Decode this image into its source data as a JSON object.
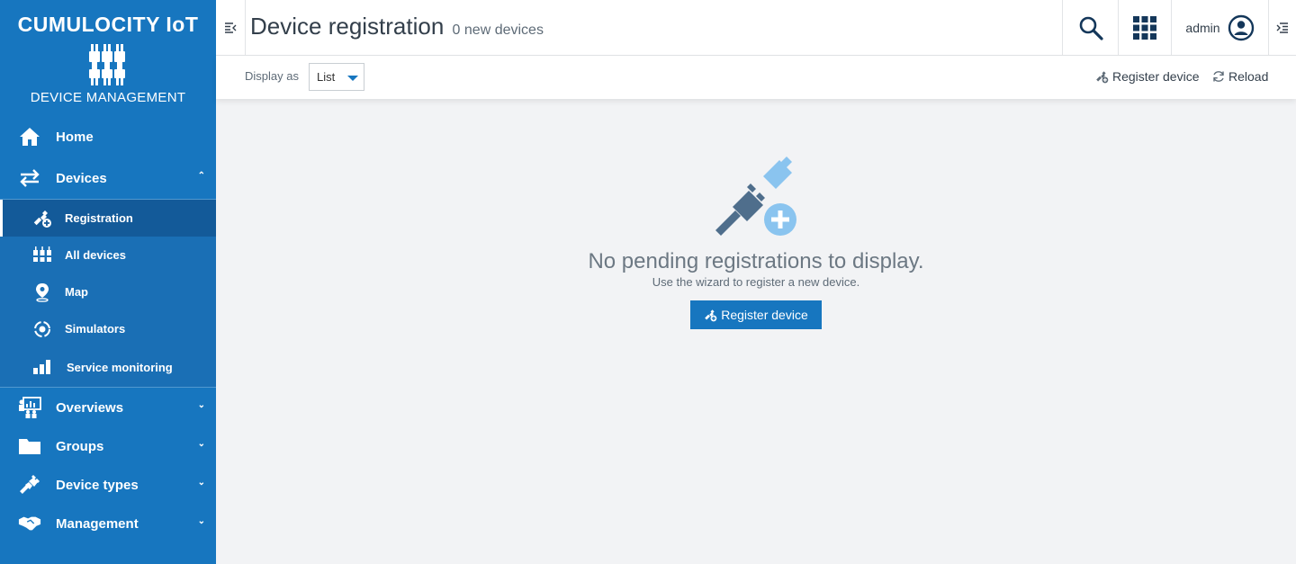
{
  "brand": {
    "title": "CUMULOCITY IoT",
    "subtitle": "DEVICE MANAGEMENT"
  },
  "nav": {
    "home": "Home",
    "devices": "Devices",
    "devices_sub": {
      "registration": "Registration",
      "all_devices": "All devices",
      "map": "Map",
      "simulators": "Simulators",
      "service_monitoring": "Service monitoring"
    },
    "overviews": "Overviews",
    "groups": "Groups",
    "device_types": "Device types",
    "management": "Management"
  },
  "header": {
    "title": "Device registration",
    "count": "0 new devices",
    "user": "admin"
  },
  "actionbar": {
    "display_as_label": "Display as",
    "display_as_value": "List",
    "register_device": "Register device",
    "reload": "Reload"
  },
  "empty": {
    "title": "No pending registrations to display.",
    "subtitle": "Use the wizard to register a new device.",
    "button": "Register device"
  },
  "colors": {
    "sidebar": "#1776bf",
    "primary": "#1776bf",
    "background": "#f2f3f5"
  }
}
